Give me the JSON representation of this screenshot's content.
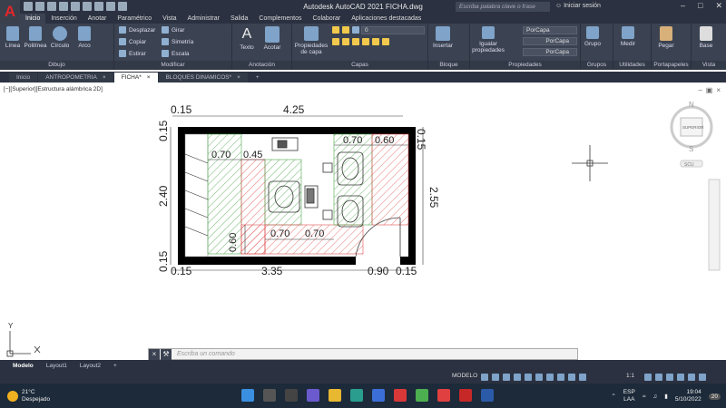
{
  "app": {
    "title": "Autodesk AutoCAD 2021   FICHA.dwg",
    "search_placeholder": "Escriba palabra clave o frase",
    "signin": "Iniciar sesión",
    "logo": "A"
  },
  "menu": [
    "Inicio",
    "Inserción",
    "Anotar",
    "Paramétrico",
    "Vista",
    "Administrar",
    "Salida",
    "Complementos",
    "Colaborar",
    "Aplicaciones destacadas"
  ],
  "ribbon": {
    "draw": {
      "label": "Dibujo",
      "linea": "Línea",
      "polilinea": "Polilínea",
      "circulo": "Círculo",
      "arco": "Arco"
    },
    "modify": {
      "label": "Modificar",
      "desplazar": "Desplazar",
      "girar": "Girar",
      "copiar": "Copiar",
      "simetria": "Simetría",
      "estirar": "Estirar",
      "escala": "Escala"
    },
    "annotation": {
      "label": "Anotación",
      "texto": "Texto",
      "acotar": "Acotar"
    },
    "layers": {
      "label": "Capas",
      "propiedades": "Propiedades de capa",
      "current": "0"
    },
    "block": {
      "label": "Bloque",
      "insertar": "Insertar"
    },
    "properties": {
      "label": "Propiedades",
      "igualar": "Igualar propiedades",
      "p1": "PorCapa",
      "p2": "PorCapa",
      "p3": "PorCapa"
    },
    "groups": {
      "label": "Grupos",
      "grupo": "Grupo"
    },
    "utilities": {
      "label": "Utilidades",
      "medir": "Medir"
    },
    "clipboard": {
      "label": "Portapapeles",
      "pegar": "Pegar"
    },
    "view": {
      "label": "Vista",
      "base": "Base"
    }
  },
  "filetabs": [
    "Inicio",
    "ANTROPOMETRIA",
    "FICHA*",
    "BLOQUES DINAMICOS*"
  ],
  "viewport": {
    "label": "[−][Superior][Estructura alámbrica 2D]",
    "compass_n": "N",
    "compass_s": "S",
    "compass_cube": "SUPERIOR",
    "ucs_label": "SCU"
  },
  "dims": {
    "top_015": "0.15",
    "top_425": "4.25",
    "left_015a": "0.15",
    "left_240": "2.40",
    "left_015b": "0.15",
    "right_015": "0.15",
    "right_255": "2.55",
    "bot_015a": "0.15",
    "bot_335": "3.35",
    "bot_090": "0.90",
    "bot_015b": "0.15",
    "in_070a": "0.70",
    "in_045": "0.45",
    "in_070b": "0.70",
    "in_060a": "0.60",
    "in_060b": "0.60",
    "in_070c": "0.70",
    "in_070d": "0.70"
  },
  "ucs": {
    "y": "Y"
  },
  "command": {
    "placeholder": "Escriba un comando"
  },
  "layouts": [
    "Modelo",
    "Layout1",
    "Layout2"
  ],
  "status": {
    "modelo": "MODELO",
    "scale": "1:1"
  },
  "taskbar": {
    "temp": "21°C",
    "weather": "Despejado",
    "lang": "ESP",
    "region": "LAA",
    "time": "19:04",
    "date": "5/10/2022",
    "badge": "20"
  },
  "colors": {
    "title_bg": "#2b3140",
    "ribbon_bg": "#3b4352",
    "hatch_red": "#e05050",
    "hatch_green": "#50a850",
    "wall": "#000000"
  }
}
